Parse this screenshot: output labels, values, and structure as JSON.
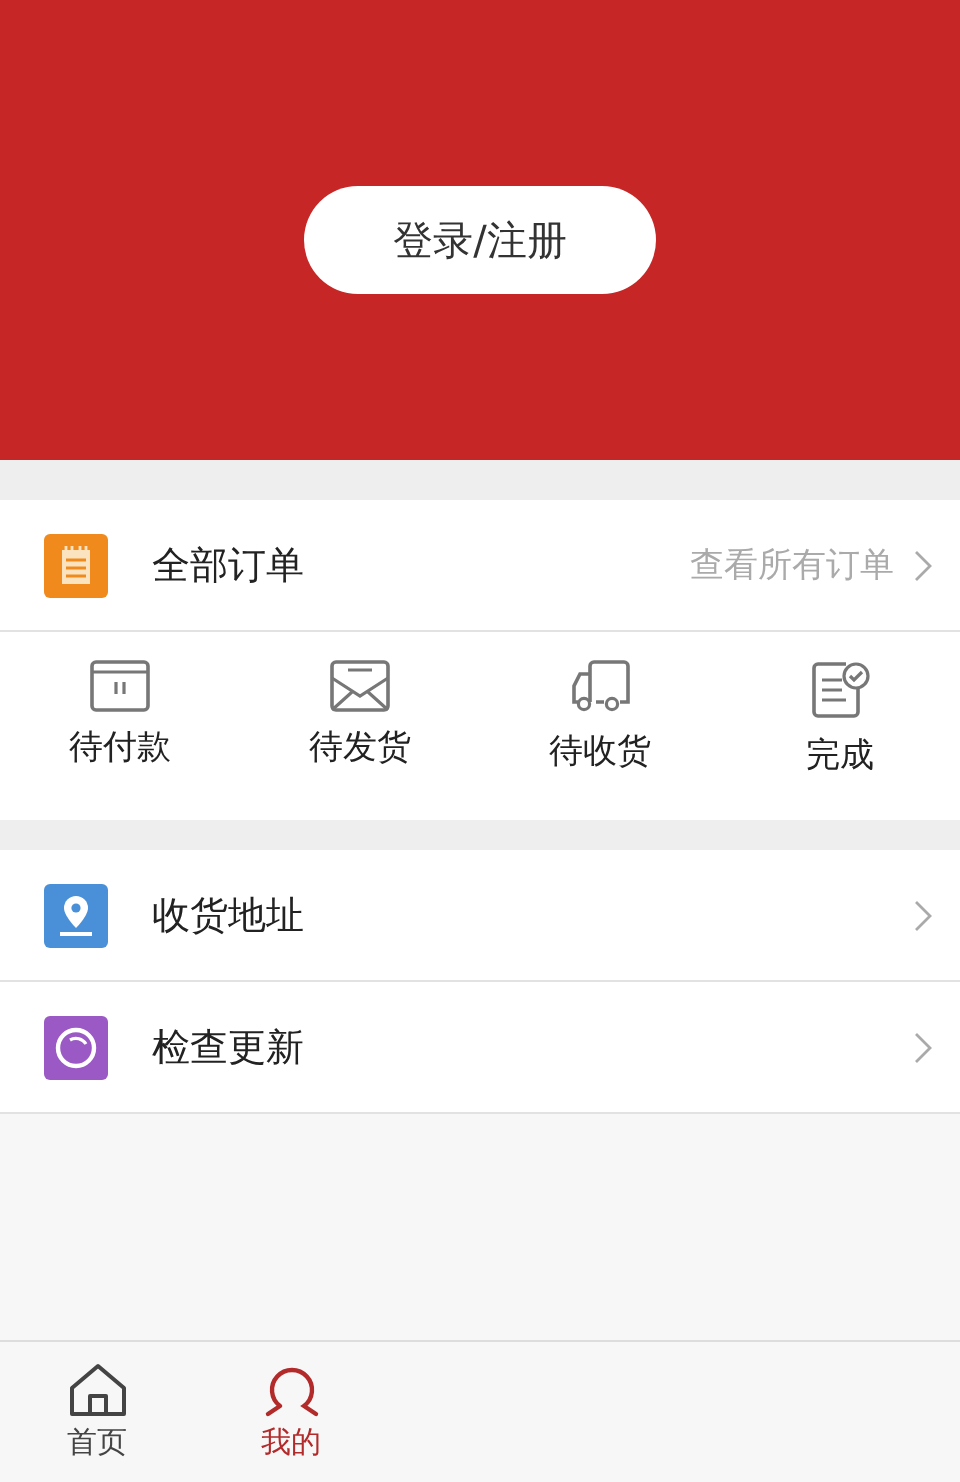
{
  "header": {
    "login_button": "登录/注册"
  },
  "orders": {
    "kind": "order",
    "label": "全部订单",
    "hint": "查看所有订单"
  },
  "order_status": [
    {
      "kind": "payment",
      "label": "待付款"
    },
    {
      "kind": "shipping",
      "label": "待发货"
    },
    {
      "kind": "delivery",
      "label": "待收货"
    },
    {
      "kind": "done",
      "label": "完成"
    }
  ],
  "menu": [
    {
      "kind": "address",
      "label": "收货地址"
    },
    {
      "kind": "update",
      "label": "检查更新"
    }
  ],
  "tabs": [
    {
      "kind": "home",
      "label": "首页",
      "selected": false
    },
    {
      "kind": "profile",
      "label": "我的",
      "selected": true
    }
  ]
}
